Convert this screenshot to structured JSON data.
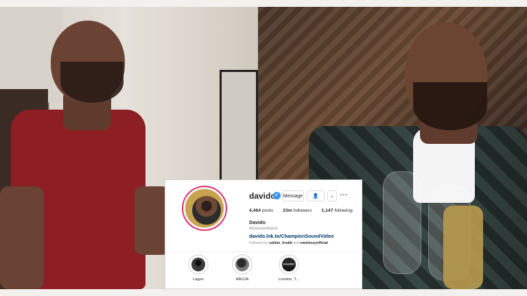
{
  "profile": {
    "username": "davido",
    "verified": true,
    "buttons": {
      "message": "Message",
      "follow_icon": "person-icon",
      "dropdown_icon": "chevron-down-icon",
      "more_icon": "more-horizontal-icon"
    },
    "stats": {
      "posts_value": "4,464",
      "posts_label": "posts",
      "followers_value": "23m",
      "followers_label": "followers",
      "following_value": "1,147",
      "following_label": "following"
    },
    "full_name": "Davido",
    "bio": "Musician/band",
    "link": "davido.lnk.to/ChampionSoundVideo",
    "followed_by_prefix": "Followed by ",
    "followed_by_user_1": "callme_froddi",
    "followed_by_middle": " and ",
    "followed_by_user_2": "omolexzyofficial",
    "highlights": [
      {
        "label": "Lagos"
      },
      {
        "label": "ABUJA"
      },
      {
        "label": "London, T..."
      }
    ]
  },
  "colors": {
    "instagram_ring": "#e1306c",
    "verified_blue": "#3897f0",
    "link_blue": "#00376b"
  }
}
